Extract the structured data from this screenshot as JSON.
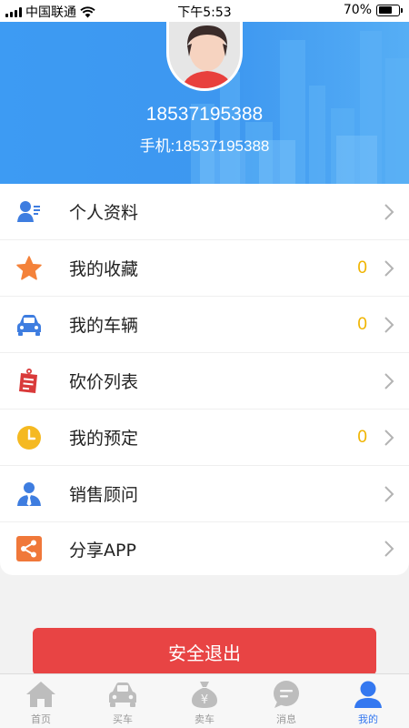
{
  "status_bar": {
    "carrier": "中国联通",
    "time": "下午5:53",
    "battery_percent": "70%",
    "battery_level": 0.7
  },
  "profile": {
    "username": "18537195388",
    "phone": "手机:18537195388",
    "header_color": "#3d9bf3"
  },
  "menu": {
    "items": [
      {
        "label": "个人资料",
        "icon": "profile-card-icon",
        "count": ""
      },
      {
        "label": "我的收藏",
        "icon": "star-icon",
        "count": "0"
      },
      {
        "label": "我的车辆",
        "icon": "car-icon",
        "count": "0"
      },
      {
        "label": "砍价列表",
        "icon": "bargain-list-icon",
        "count": ""
      },
      {
        "label": "我的预定",
        "icon": "clock-icon",
        "count": "0"
      },
      {
        "label": "销售顾问",
        "icon": "advisor-icon",
        "count": ""
      },
      {
        "label": "分享APP",
        "icon": "share-icon",
        "count": ""
      }
    ],
    "count_color": "#f0b400"
  },
  "logout": {
    "label": "安全退出",
    "color": "#e84444"
  },
  "tabbar": {
    "items": [
      {
        "label": "首页",
        "icon": "home-icon",
        "active": false
      },
      {
        "label": "买车",
        "icon": "buy-car-icon",
        "active": false
      },
      {
        "label": "卖车",
        "icon": "money-bag-icon",
        "active": false
      },
      {
        "label": "消息",
        "icon": "message-icon",
        "active": false
      },
      {
        "label": "我的",
        "icon": "user-icon",
        "active": true
      }
    ],
    "active_color": "#3478f0"
  }
}
